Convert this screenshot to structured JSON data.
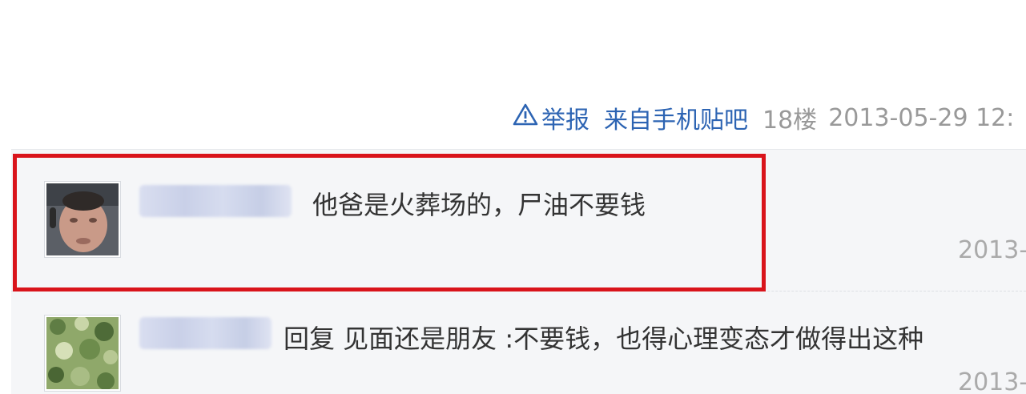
{
  "post_tail": {
    "report_label": "举报",
    "client_label": "来自手机贴吧",
    "floor": "18楼",
    "timestamp": "2013-05-29 12:"
  },
  "replies": [
    {
      "username": "",
      "content": "他爸是火葬场的，尸油不要钱",
      "date": "2013-",
      "highlighted": true
    },
    {
      "username": "",
      "content": "回复 见面还是朋友 :不要钱，也得心理变态才做得出这种",
      "date": "2013-",
      "highlighted": false
    }
  ],
  "colors": {
    "link": "#2d64b3",
    "meta_gray": "#999999",
    "highlight_border": "#d9141b",
    "reply_background": "#f5f6f8"
  },
  "icons": {
    "report": "warning-triangle-icon"
  }
}
